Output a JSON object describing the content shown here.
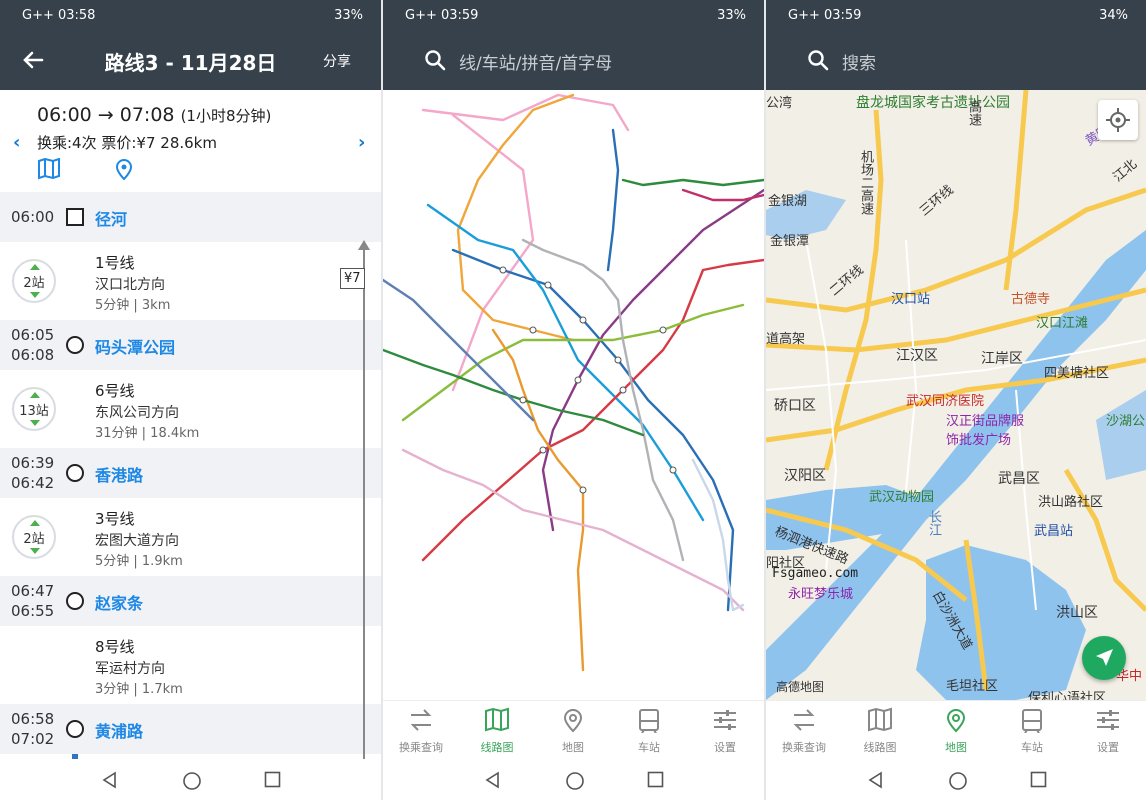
{
  "status": {
    "p1": {
      "left": "G++ 03:58",
      "right": "33%"
    },
    "p2": {
      "left": "G++ 03:59",
      "right": "33%"
    },
    "p3": {
      "left": "G++ 03:59",
      "right": "34%"
    }
  },
  "route": {
    "title": "路线3 - 11月28日",
    "share": "分享",
    "time_range": "06:00 → 07:08",
    "duration": "(1小时8分钟)",
    "info": "换乘:4次  票价:¥7  28.6km",
    "fare_tag": "¥7",
    "stops": [
      {
        "time": "06:00",
        "name": "径河"
      },
      {
        "time": "06:05\n06:08",
        "name": "码头潭公园"
      },
      {
        "time": "06:39\n06:42",
        "name": "香港路"
      },
      {
        "time": "06:47\n06:55",
        "name": "赵家条"
      },
      {
        "time": "06:58\n07:02",
        "name": "黄浦路"
      }
    ],
    "segments": [
      {
        "badge": "2站",
        "line": "1号线",
        "direction": "汉口北方向",
        "duration": "5分钟 | 3km"
      },
      {
        "badge": "13站",
        "line": "6号线",
        "direction": "东风公司方向",
        "duration": "31分钟 | 18.4km"
      },
      {
        "badge": "2站",
        "line": "3号线",
        "direction": "宏图大道方向",
        "duration": "5分钟 | 1.9km"
      },
      {
        "badge": "",
        "line": "8号线",
        "direction": "军运村方向",
        "duration": "3分钟 | 1.7km"
      }
    ]
  },
  "search": {
    "p2_placeholder": "线/车站/拼音/首字母",
    "p3_placeholder": "搜索"
  },
  "tabs": [
    "换乘查询",
    "线路图",
    "地图",
    "车站",
    "设置"
  ],
  "map": {
    "labels": [
      "盘龙城国家考古遗址公园",
      "汉口站",
      "古德寺",
      "汉口江滩",
      "江汉区",
      "江岸区",
      "四美塘社区",
      "武汉同济医院",
      "汉正街品牌服饰批发广场",
      "硚口区",
      "沙湖公",
      "汉阳区",
      "武昌区",
      "武汉动物园",
      "洪山路社区",
      "武昌站",
      "杨泗港快速路",
      "永旺梦乐城",
      "洪山区",
      "毛坦社区",
      "保利心语社区",
      "机场二高速",
      "三环线",
      "二环线",
      "高速",
      "江北",
      "黄陂",
      "公湾",
      "金银湖",
      "金银潭",
      "道高架",
      "长江",
      "白沙洲大道",
      "阳社区",
      "华中"
    ],
    "watermark": "Fsgameo.com",
    "provider": "高德地图"
  },
  "colors": {
    "line1": "#2f74c0",
    "line6": "#2e8b3d",
    "line3": "#e3b87a",
    "line8": "#a8c4d8",
    "accent": "#1e88e5",
    "active_tab": "#3aa45b",
    "bar": "#37414b"
  }
}
